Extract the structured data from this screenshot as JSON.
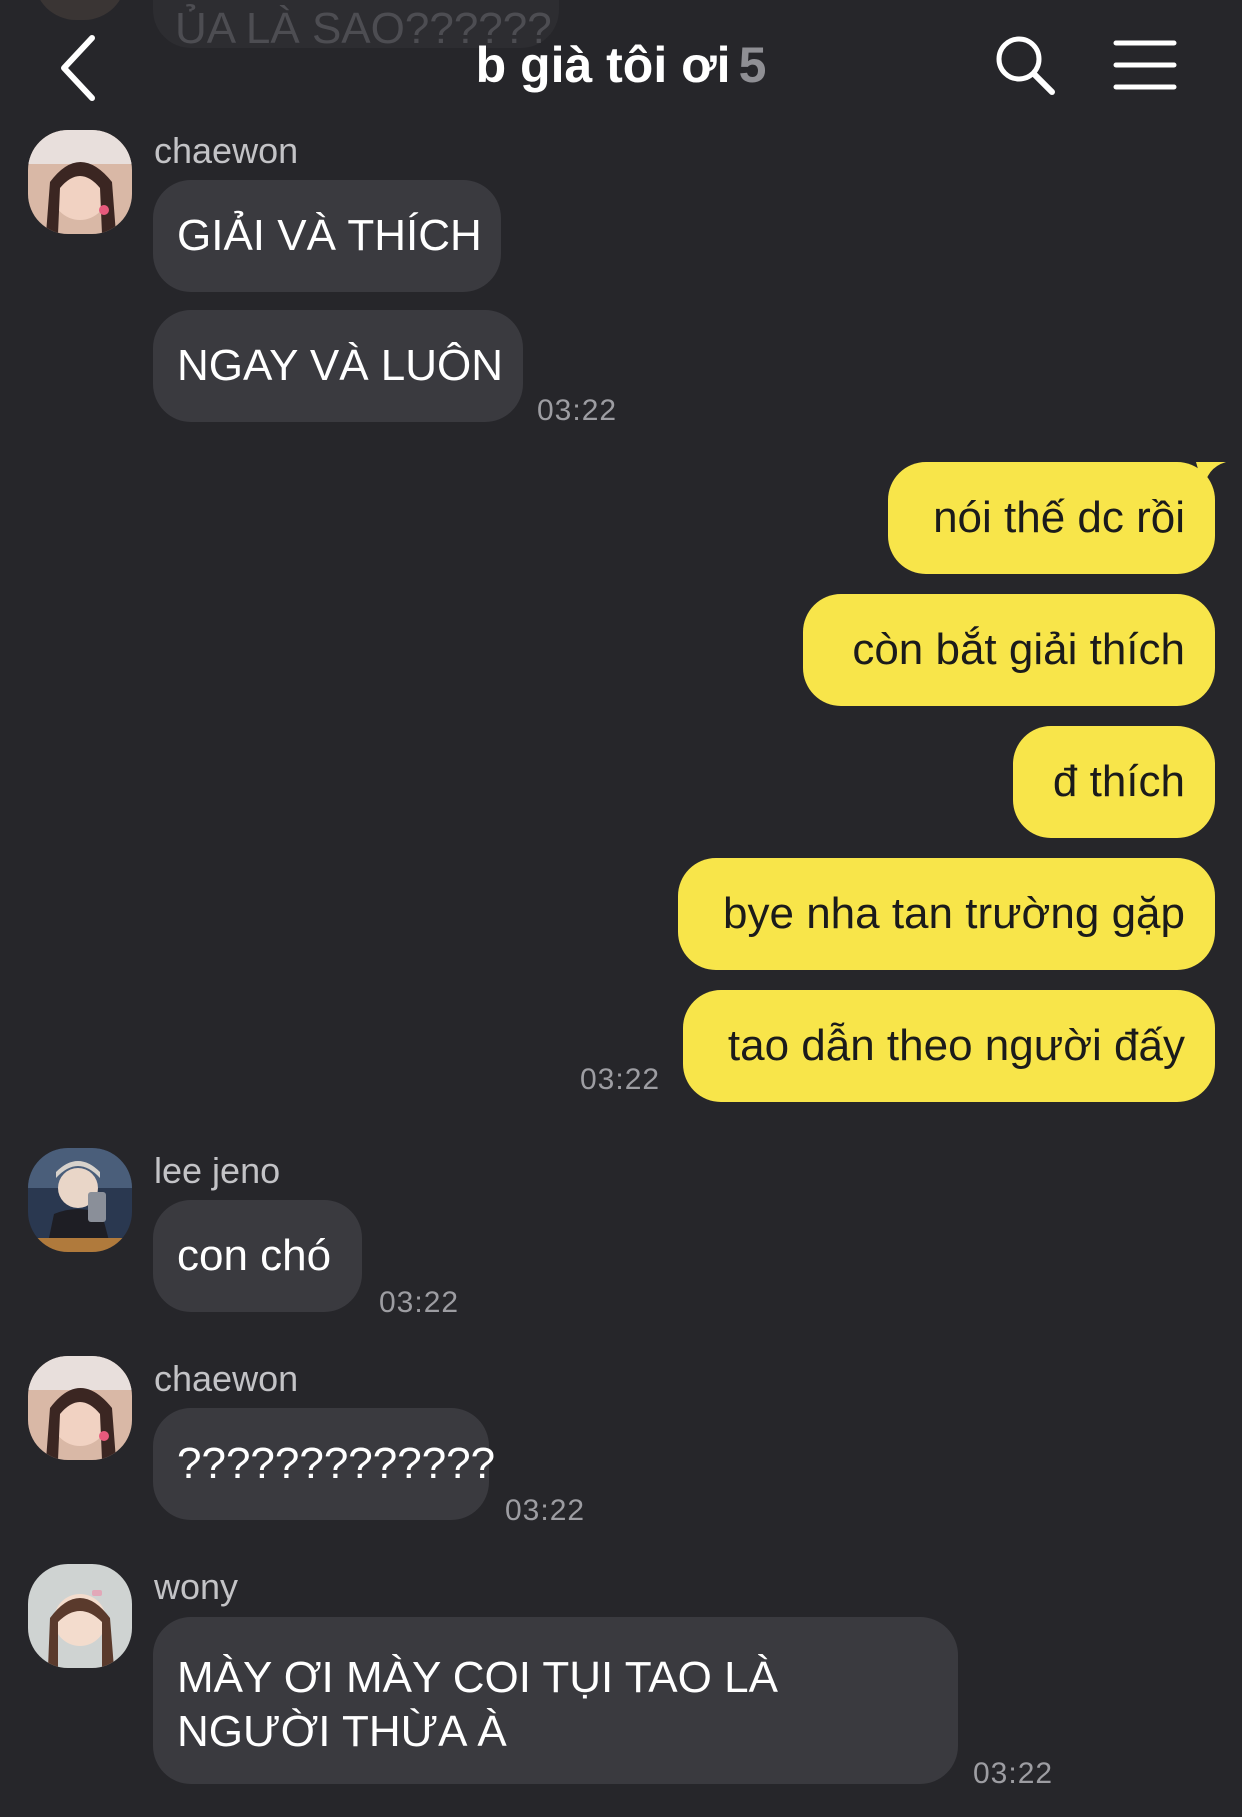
{
  "header": {
    "title": "b già tôi ơi",
    "member_count": "5",
    "back_icon": "chevron-left-icon",
    "search_icon": "search-icon",
    "menu_icon": "hamburger-menu-icon"
  },
  "colors": {
    "background": "#26262a",
    "incoming_bubble": "#3a3a3f",
    "outgoing_bubble": "#f8e54a",
    "timestamp": "#9d9da2"
  },
  "messages": {
    "cutoff_top": {
      "text": "ỦA LÀ SAO??????"
    },
    "group1": {
      "sender": "chaewon",
      "bubbles": [
        "GIẢI VÀ THÍCH",
        "NGAY VÀ LUÔN"
      ],
      "time": "03:22"
    },
    "outgoing": {
      "bubbles": [
        "nói thế dc rồi",
        "còn bắt giải thích",
        "đ thích",
        "bye nha tan trường gặp",
        "tao dẫn theo người đấy"
      ],
      "time": "03:22"
    },
    "group2": {
      "sender": "lee jeno",
      "bubbles": [
        "con chó"
      ],
      "time": "03:22"
    },
    "group3": {
      "sender": "chaewon",
      "bubbles": [
        "?????????????"
      ],
      "time": "03:22"
    },
    "group4": {
      "sender": "wony",
      "bubbles": [
        "MÀY ƠI MÀY COI TỤI TAO LÀ NGƯỜI THỪA À"
      ],
      "time": "03:22"
    }
  }
}
